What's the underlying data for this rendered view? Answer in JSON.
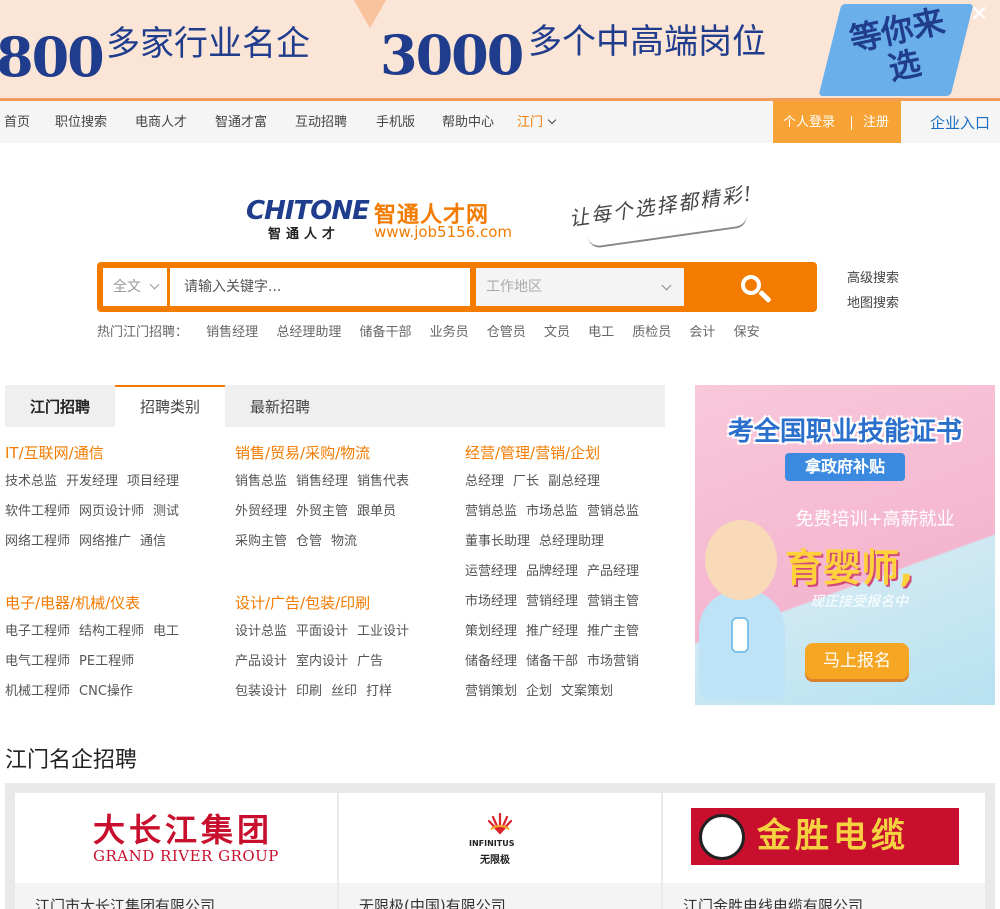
{
  "banner": {
    "num1": "800",
    "text1": "多家行业名企",
    "num2": "3000",
    "text2": "多个中高端岗位",
    "badge": "等你来选",
    "close": "✕"
  },
  "nav": {
    "items": [
      "首页",
      "职位搜索",
      "电商人才",
      "智通才富",
      "互动招聘",
      "手机版",
      "帮助中心"
    ],
    "city": "江门",
    "login": "个人登录",
    "register": "注册",
    "corp": "企业入口"
  },
  "logo": {
    "brand_en": "CHITONE",
    "brand_cn_small": "智通人才",
    "brand_cn": "智通人才网",
    "url": "www.job5156.com",
    "slogan": "让每个选择都精彩!"
  },
  "search": {
    "type": "全文",
    "placeholder": "请输入关键字...",
    "area_placeholder": "工作地区",
    "advanced": "高级搜索",
    "map": "地图搜索"
  },
  "hot": {
    "label": "热门江门招聘：",
    "keywords": [
      "销售经理",
      "总经理助理",
      "储备干部",
      "业务员",
      "仓管员",
      "文员",
      "电工",
      "质检员",
      "会计",
      "保安"
    ]
  },
  "tabs": [
    "江门招聘",
    "招聘类别",
    "最新招聘"
  ],
  "categories": [
    {
      "head": "IT/互联网/通信",
      "rows": [
        [
          "技术总监",
          "开发经理",
          "项目经理"
        ],
        [
          "软件工程师",
          "网页设计师",
          "测试"
        ],
        [
          "网络工程师",
          "网络推广",
          "通信"
        ]
      ]
    },
    {
      "head": "销售/贸易/采购/物流",
      "rows": [
        [
          "销售总监",
          "销售经理",
          "销售代表"
        ],
        [
          "外贸经理",
          "外贸主管",
          "跟单员"
        ],
        [
          "采购主管",
          "仓管",
          "物流"
        ]
      ]
    },
    {
      "head": "经营/管理/营销/企划",
      "rows": [
        [
          "总经理",
          "厂长",
          "副总经理"
        ],
        [
          "营销总监",
          "市场总监",
          "营销总监"
        ],
        [
          "董事长助理",
          "总经理助理"
        ],
        [
          "运营经理",
          "品牌经理",
          "产品经理"
        ],
        [
          "市场经理",
          "营销经理",
          "营销主管"
        ],
        [
          "策划经理",
          "推广经理",
          "推广主管"
        ],
        [
          "储备经理",
          "储备干部",
          "市场营销"
        ],
        [
          "营销策划",
          "企划",
          "文案策划"
        ]
      ]
    },
    {
      "head": "电子/电器/机械/仪表",
      "rows": [
        [
          "电子工程师",
          "结构工程师",
          "电工"
        ],
        [
          "电气工程师",
          "PE工程师"
        ],
        [
          "机械工程师",
          "CNC操作"
        ]
      ]
    },
    {
      "head": "设计/广告/包装/印刷",
      "rows": [
        [
          "设计总监",
          "平面设计",
          "工业设计"
        ],
        [
          "产品设计",
          "室内设计",
          "广告"
        ],
        [
          "包装设计",
          "印刷",
          "丝印",
          "打样"
        ]
      ]
    }
  ],
  "ad": {
    "title": "考全国职业技能证书",
    "subtitle": "拿政府补贴",
    "line": "免费培训+高薪就业",
    "big": "育婴师,",
    "small": "现正接受报名中",
    "button": "马上报名"
  },
  "famous": {
    "title": "江门名企招聘",
    "companies": [
      {
        "logo_cn": "大长江集团",
        "logo_en": "GRAND RIVER GROUP",
        "name": "江门市大长江集团有限公司"
      },
      {
        "logo_en": "INFINITUS",
        "logo_cn": "无限极",
        "name": "无限极(中国)有限公司"
      },
      {
        "logo_cn": "金胜电缆",
        "name": "江门金胜电线电缆有限公司"
      }
    ]
  }
}
